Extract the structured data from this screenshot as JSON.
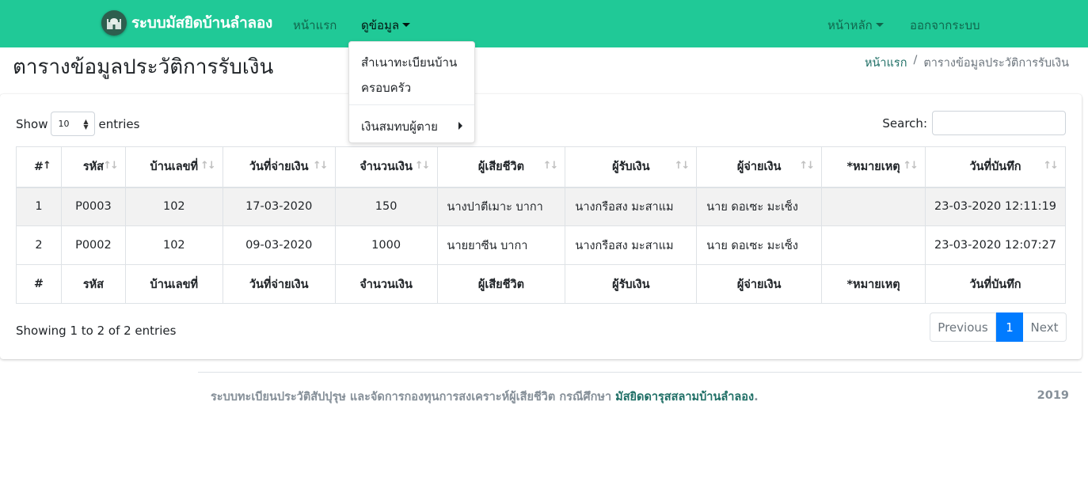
{
  "navbar": {
    "brand": "ระบบมัสยิดบ้านลำลอง",
    "links": [
      "หน้าแรก",
      "ดูข้อมูล"
    ],
    "right_links": [
      "หน้าหลัก",
      "ออกจากระบบ"
    ],
    "color": "#20c997"
  },
  "dropdown": {
    "items": [
      "สำเนาทะเบียนบ้าน",
      "ครอบครัว",
      "เงินสมทบผู้ตาย"
    ]
  },
  "page": {
    "title": "ตารางข้อมูลประวัติการรับเงิน",
    "breadcrumb": [
      "หน้าแรก",
      "/",
      "ตารางข้อมูลประวัติการรับเงิน"
    ]
  },
  "table_controls": {
    "show_label": "Show",
    "length_value": "10",
    "entries_label": "entries",
    "search_label": "Search:",
    "search_value": ""
  },
  "table": {
    "columns": [
      "#",
      "รหัส",
      "บ้านเลขที่",
      "วันที่จ่ายเงิน",
      "จำนวนเงิน",
      "ผู้เสียชีวิต",
      "ผู้รับเงิน",
      "ผู้จ่ายเงิน",
      "*หมายเหตุ",
      "วันที่บันทึก"
    ],
    "rows": [
      [
        "1",
        "P0003",
        "102",
        "17-03-2020",
        "150",
        "นางปาตีเมาะ บากา",
        "นางกรือสง มะสาแม",
        "นาย ดอเซะ มะเซ็ง",
        "",
        "23-03-2020 12:11:19"
      ],
      [
        "2",
        "P0002",
        "102",
        "09-03-2020",
        "1000",
        "นายยาซีน บากา",
        "นางกรือสง มะสาแม",
        "นาย ดอเซะ มะเซ็ง",
        "",
        "23-03-2020 12:07:27"
      ]
    ]
  },
  "footer_info": "Showing 1 to 2 of 2 entries",
  "pagination": {
    "previous": "Previous",
    "current": "1",
    "next": "Next"
  },
  "footer": {
    "text": "ระบบทะเบียนประวัติสัปปุรุษ และจัดการกองทุนการสงเคราะห์ผู้เสียชีวิต กรณีศึกษา ",
    "link": "มัสยิดดารุสสลามบ้านลำลอง",
    "end": ".",
    "year": "2019"
  }
}
